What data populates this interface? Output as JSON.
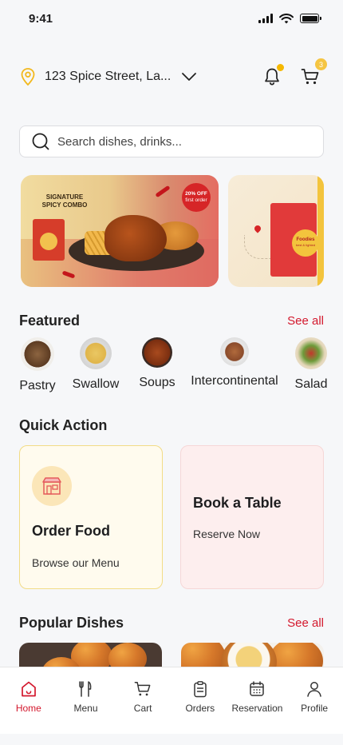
{
  "status_bar": {
    "time": "9:41"
  },
  "header": {
    "location": "123 Spice Street, La...",
    "cart_count": "3"
  },
  "search": {
    "placeholder": "Search dishes, drinks..."
  },
  "banners": [
    {
      "title": "SIGNATURE SPICY COMBO",
      "promo_line1": "20% OFF",
      "promo_line2": "first order"
    },
    {
      "brand": "Foodies",
      "brand_sub": "best & lighted"
    }
  ],
  "featured": {
    "title": "Featured",
    "see_all": "See all",
    "items": [
      {
        "label": "Pastry",
        "icon": "pastry-dish",
        "color": "#6b4a2e"
      },
      {
        "label": "Swallow",
        "icon": "swallow-dish",
        "color": "#e8c15a"
      },
      {
        "label": "Soups",
        "icon": "soup-dish",
        "color": "#8a3a1a"
      },
      {
        "label": "Intercontinental",
        "icon": "pasta-dish",
        "color": "#9a5a3a"
      },
      {
        "label": "Salad",
        "icon": "salad-dish",
        "color": "#5e8a3a"
      }
    ]
  },
  "quick_action": {
    "title": "Quick Action",
    "order": {
      "title": "Order Food",
      "subtitle": "Browse our Menu",
      "icon": "restaurant-store-icon"
    },
    "book": {
      "title": "Book a Table",
      "subtitle": "Reserve Now"
    }
  },
  "popular": {
    "title": "Popular Dishes",
    "see_all": "See all"
  },
  "bottom_nav": [
    {
      "label": "Home",
      "icon": "home-icon",
      "active": true
    },
    {
      "label": "Menu",
      "icon": "fork-knife-icon",
      "active": false
    },
    {
      "label": "Cart",
      "icon": "cart-icon",
      "active": false
    },
    {
      "label": "Orders",
      "icon": "clipboard-icon",
      "active": false
    },
    {
      "label": "Reservation",
      "icon": "calendar-icon",
      "active": false
    },
    {
      "label": "Profile",
      "icon": "user-icon",
      "active": false
    }
  ],
  "colors": {
    "accent": "#d3182d",
    "order_card_bg": "#fffbee",
    "book_card_bg": "#fdeeee",
    "badge": "#f5c542"
  }
}
